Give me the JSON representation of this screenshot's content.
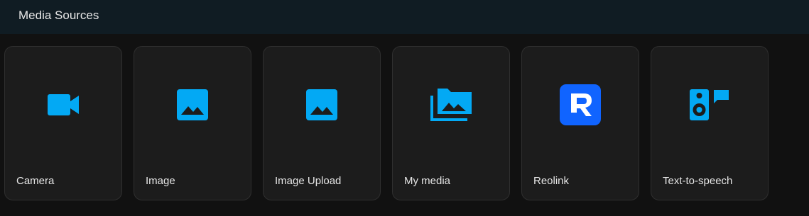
{
  "header": {
    "title": "Media Sources"
  },
  "colors": {
    "icon": "#03a9f4",
    "reolink_brand": "#1064ff",
    "card_bg": "#1c1c1c",
    "header_bg": "#101c23"
  },
  "sources": [
    {
      "label": "Camera",
      "icon": "video-camera-icon"
    },
    {
      "label": "Image",
      "icon": "image-icon"
    },
    {
      "label": "Image Upload",
      "icon": "image-icon"
    },
    {
      "label": "My media",
      "icon": "folder-multiple-image-icon"
    },
    {
      "label": "Reolink",
      "icon": "reolink-logo-icon"
    },
    {
      "label": "Text-to-speech",
      "icon": "speaker-message-icon"
    }
  ]
}
